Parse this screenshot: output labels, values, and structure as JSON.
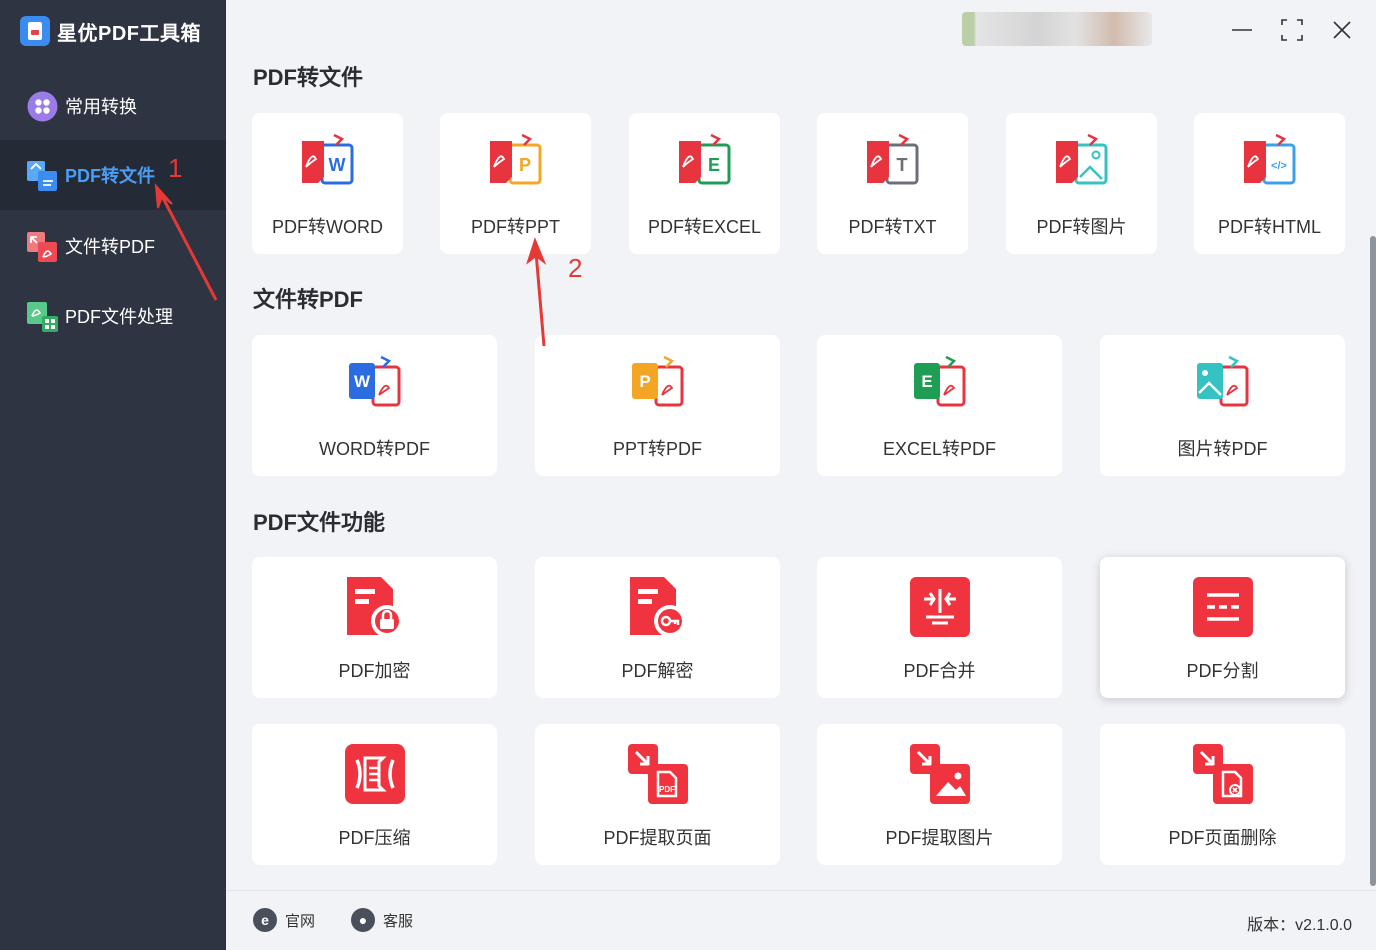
{
  "app": {
    "title": "星优PDF工具箱"
  },
  "sidebar": {
    "items": [
      {
        "label": "常用转换",
        "icon": "grid-icon"
      },
      {
        "label": "PDF转文件",
        "icon": "pdf-to-file-icon",
        "active": true
      },
      {
        "label": "文件转PDF",
        "icon": "file-to-pdf-icon"
      },
      {
        "label": "PDF文件处理",
        "icon": "pdf-process-icon"
      }
    ]
  },
  "sections": {
    "pdf_to_file": {
      "title": "PDF转文件",
      "cards": [
        {
          "label": "PDF转WORD",
          "color": "#2b6de0",
          "letter": "W"
        },
        {
          "label": "PDF转PPT",
          "color": "#f5a524",
          "letter": "P"
        },
        {
          "label": "PDF转EXCEL",
          "color": "#1f9d55",
          "letter": "E"
        },
        {
          "label": "PDF转TXT",
          "color": "#6b6f78",
          "letter": "T"
        },
        {
          "label": "PDF转图片",
          "color": "#35c2c2",
          "letter": ""
        },
        {
          "label": "PDF转HTML",
          "color": "#3aa0ea",
          "letter": "</>"
        }
      ]
    },
    "file_to_pdf": {
      "title": "文件转PDF",
      "cards": [
        {
          "label": "WORD转PDF",
          "color": "#2b6de0",
          "letter": "W"
        },
        {
          "label": "PPT转PDF",
          "color": "#f5a524",
          "letter": "P"
        },
        {
          "label": "EXCEL转PDF",
          "color": "#1f9d55",
          "letter": "E"
        },
        {
          "label": "图片转PDF",
          "color": "#35c2c2",
          "letter": ""
        }
      ]
    },
    "pdf_functions": {
      "title": "PDF文件功能",
      "cards": [
        {
          "label": "PDF加密",
          "icon": "lock-icon"
        },
        {
          "label": "PDF解密",
          "icon": "key-icon"
        },
        {
          "label": "PDF合并",
          "icon": "merge-icon"
        },
        {
          "label": "PDF分割",
          "icon": "split-icon"
        },
        {
          "label": "PDF压缩",
          "icon": "compress-icon"
        },
        {
          "label": "PDF提取页面",
          "icon": "extract-page-icon"
        },
        {
          "label": "PDF提取图片",
          "icon": "extract-image-icon"
        },
        {
          "label": "PDF页面删除",
          "icon": "delete-page-icon"
        }
      ]
    }
  },
  "footer": {
    "website_label": "官网",
    "support_label": "客服",
    "version": "版本：v2.1.0.0"
  },
  "annotations": {
    "step1": "1",
    "step2": "2"
  },
  "colors": {
    "accent_red": "#f0343f",
    "sidebar_bg": "#2f3443",
    "active_blue": "#4a9ef5"
  }
}
